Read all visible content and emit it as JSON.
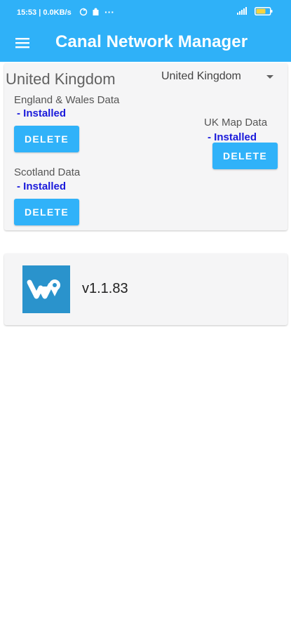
{
  "status_bar": {
    "time": "15:53",
    "net_speed": "| 0.0KB/s",
    "more": "···",
    "battery_level": "61"
  },
  "app_bar": {
    "title": "Canal Network Manager",
    "menu_icon": "hamburger-menu-icon"
  },
  "region": {
    "title": "United Kingdom",
    "selected_country": "United Kingdom"
  },
  "packages": [
    {
      "label": "England & Wales Data",
      "status": "- Installed",
      "action": "DELETE"
    },
    {
      "label": "UK Map Data",
      "status": "- Installed",
      "action": "DELETE"
    },
    {
      "label": "Scotland Data",
      "status": "- Installed",
      "action": "DELETE"
    }
  ],
  "version": {
    "text": "v1.1.83",
    "logo_color": "#2a93cc"
  },
  "colors": {
    "primary": "#2fb1f8",
    "button": "#30b2f9",
    "installed": "#1a1adb"
  }
}
